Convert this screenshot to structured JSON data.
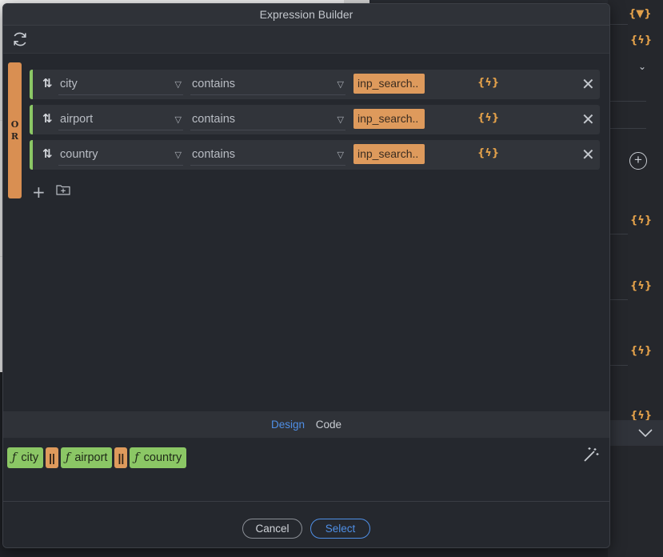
{
  "dialog": {
    "title": "Expression Builder"
  },
  "group": {
    "operator_letters": [
      "O",
      "R"
    ]
  },
  "rules": [
    {
      "field": "city",
      "operator": "contains",
      "value": "inp_search..",
      "bind_icon": "{ϟ}"
    },
    {
      "field": "airport",
      "operator": "contains",
      "value": "inp_search..",
      "bind_icon": "{ϟ}"
    },
    {
      "field": "country",
      "operator": "contains",
      "value": "inp_search..",
      "bind_icon": "{ϟ}"
    }
  ],
  "tabs": {
    "design": "Design",
    "code": "Code"
  },
  "expression": {
    "fn_symbol": "ƒ",
    "or_symbol": "||",
    "terms": [
      "city",
      "airport",
      "country"
    ]
  },
  "buttons": {
    "cancel": "Cancel",
    "select": "Select"
  },
  "background": {
    "filter_icon": "{▼}",
    "bind_icon": "{ϟ}",
    "add_symbol": "+"
  },
  "colors": {
    "accent_blue": "#4f8fe6",
    "or_orange": "#d98f52",
    "rule_green": "#8bc765",
    "value_orange": "#de9a5c"
  }
}
